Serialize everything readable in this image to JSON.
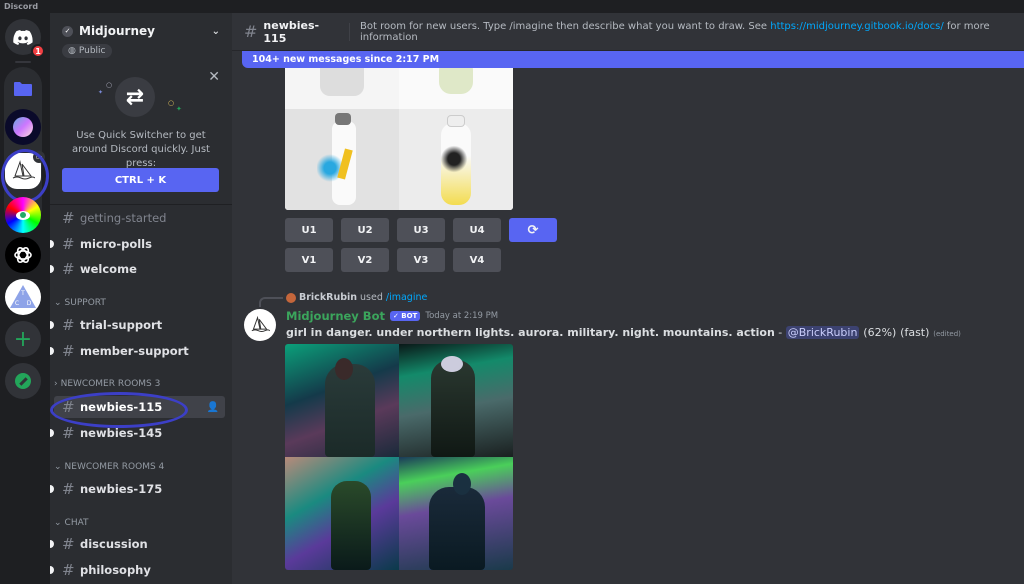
{
  "app": {
    "title": "Discord"
  },
  "guilds": {
    "home_badge": "1",
    "items": [
      {
        "name": "home",
        "icon": "discord-icon"
      },
      {
        "name": "folder",
        "icon": "folder-icon"
      },
      {
        "name": "orb-server",
        "icon": "orb-icon"
      },
      {
        "name": "midjourney",
        "icon": "sailboat-icon",
        "selected": true
      },
      {
        "name": "eye-server",
        "icon": "eye-icon"
      },
      {
        "name": "openai-server",
        "icon": "openai-icon"
      },
      {
        "name": "tcd-server",
        "icon": "tcd-icon",
        "label": "T C D"
      },
      {
        "name": "add-server",
        "icon": "plus-icon"
      },
      {
        "name": "explore",
        "icon": "compass-icon"
      }
    ]
  },
  "server": {
    "name": "Midjourney",
    "visibility": "Public",
    "quick_switcher": {
      "text": "Use Quick Switcher to get around Discord quickly. Just press:",
      "button": "CTRL + K"
    },
    "channels_top": [
      {
        "name": "getting-started",
        "muted": true
      },
      {
        "name": "micro-polls",
        "unread": true
      },
      {
        "name": "welcome",
        "unread": true
      }
    ],
    "categories": [
      {
        "name": "SUPPORT",
        "collapsed": false,
        "channels": [
          {
            "name": "trial-support"
          },
          {
            "name": "member-support"
          }
        ]
      },
      {
        "name": "NEWCOMER ROOMS 3",
        "collapsed": true,
        "channels": [
          {
            "name": "newbies-115",
            "active": true
          },
          {
            "name": "newbies-145"
          }
        ]
      },
      {
        "name": "NEWCOMER ROOMS 4",
        "collapsed": false,
        "channels": [
          {
            "name": "newbies-175"
          }
        ]
      },
      {
        "name": "CHAT",
        "collapsed": false,
        "channels": [
          {
            "name": "discussion"
          },
          {
            "name": "philosophy"
          }
        ]
      }
    ]
  },
  "channel": {
    "name": "newbies-115",
    "topic_prefix": "Bot room for new users. Type /imagine then describe what you want to draw. See ",
    "topic_link": "https://midjourney.gitbook.io/docs/",
    "topic_suffix": " for more information",
    "new_messages": "104+ new messages since 2:17 PM"
  },
  "messages": [
    {
      "image_alt": "Four AI-generated images of sports water bottles with paint splashes",
      "buttons_upscale": [
        "U1",
        "U2",
        "U3",
        "U4"
      ],
      "buttons_variation": [
        "V1",
        "V2",
        "V3",
        "V4"
      ],
      "reroll_icon": "refresh-icon"
    },
    {
      "reply_user": "BrickRubin",
      "reply_used": "used",
      "reply_command": "/imagine",
      "author": "Midjourney Bot",
      "bot_badge": "✓ BOT",
      "timestamp": "Today at 2:19 PM",
      "prompt": "girl in danger. under northern lights. aurora. military. night. mountains. action",
      "dash": " - ",
      "mention": "@BrickRubin",
      "progress": "(62%)",
      "mode": "(fast)",
      "edited": "(edited)",
      "image_alt": "Four AI-generated images of a girl in parka under aurora in mountains"
    }
  ],
  "colors": {
    "accent": "#5865f2",
    "bot_name": "#3ba55c",
    "link": "#00a8fc"
  }
}
